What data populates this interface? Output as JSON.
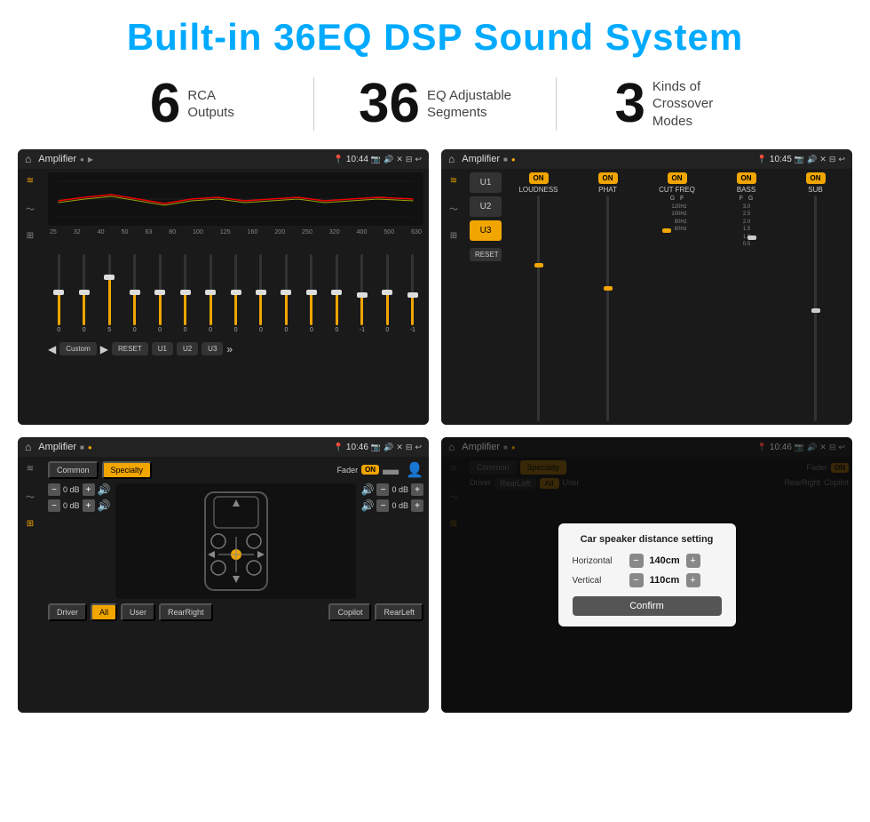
{
  "header": {
    "title": "Built-in 36EQ DSP Sound System"
  },
  "stats": [
    {
      "number": "6",
      "label": "RCA\nOutputs"
    },
    {
      "number": "36",
      "label": "EQ Adjustable\nSegments"
    },
    {
      "number": "3",
      "label": "Kinds of\nCrossover Modes"
    }
  ],
  "screens": [
    {
      "id": "screen1",
      "time": "10:44",
      "app": "Amplifier",
      "description": "EQ Screen",
      "eq_freqs": [
        "25",
        "32",
        "40",
        "50",
        "63",
        "80",
        "100",
        "125",
        "160",
        "200",
        "250",
        "320",
        "400",
        "500",
        "630"
      ],
      "eq_values": [
        "0",
        "0",
        "5",
        "0",
        "0",
        "0",
        "0",
        "0",
        "0",
        "0",
        "0",
        "0",
        "-1",
        "0",
        "-1"
      ],
      "controls": [
        "Custom",
        "RESET",
        "U1",
        "U2",
        "U3"
      ]
    },
    {
      "id": "screen2",
      "time": "10:45",
      "app": "Amplifier",
      "description": "Amplifier Channels",
      "u_options": [
        "U1",
        "U2",
        "U3"
      ],
      "active_u": "U3",
      "channels": [
        "LOUDNESS",
        "PHAT",
        "CUT FREQ",
        "BASS",
        "SUB"
      ],
      "channel_on": [
        true,
        true,
        true,
        true,
        true
      ],
      "reset_label": "RESET"
    },
    {
      "id": "screen3",
      "time": "10:46",
      "app": "Amplifier",
      "description": "Speaker Fader",
      "tabs": [
        "Common",
        "Specialty"
      ],
      "active_tab": "Specialty",
      "fader_label": "Fader",
      "fader_on": "ON",
      "db_values": [
        "0 dB",
        "0 dB",
        "0 dB",
        "0 dB"
      ],
      "bottom_btns": [
        "Driver",
        "All",
        "User",
        "RearRight",
        "RearLeft",
        "Copilot"
      ]
    },
    {
      "id": "screen4",
      "time": "10:46",
      "app": "Amplifier",
      "description": "Speaker Distance Setting",
      "dialog": {
        "title": "Car speaker distance setting",
        "horizontal_label": "Horizontal",
        "horizontal_value": "140cm",
        "vertical_label": "Vertical",
        "vertical_value": "110cm",
        "confirm_label": "Confirm"
      }
    }
  ],
  "icons": {
    "home": "⌂",
    "back": "↩",
    "eq": "≋",
    "wave": "〜",
    "dots": "⊞",
    "camera": "📷",
    "speaker": "🔊",
    "close": "✕",
    "pin": "📍"
  }
}
